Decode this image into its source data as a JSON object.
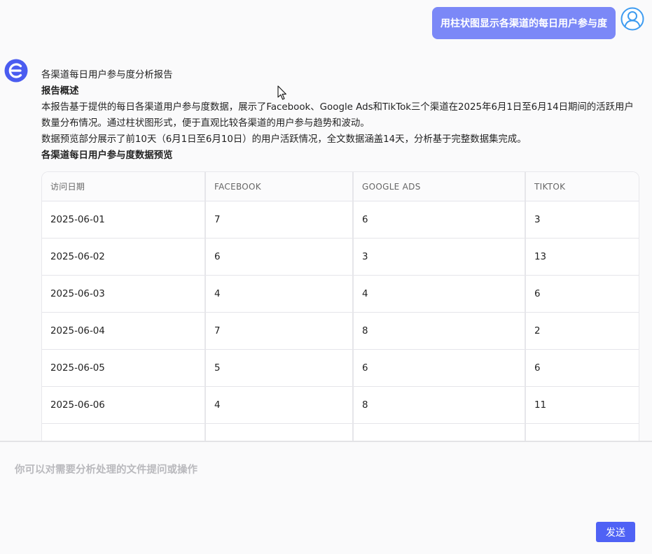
{
  "user_message": {
    "text": "用柱状图显示各渠道的每日用户参与度"
  },
  "report": {
    "title": "各渠道每日用户参与度分析报告",
    "overview_heading": "报告概述",
    "overview_text": "本报告基于提供的每日各渠道用户参与度数据，展示了Facebook、Google Ads和TikTok三个渠道在2025年6月1日至6月14日期间的活跃用户数量分布情况。通过柱状图形式，便于直观比较各渠道的用户参与趋势和波动。",
    "preview_text": "数据预览部分展示了前10天（6月1日至6月10日）的用户活跃情况，全文数据涵盖14天，分析基于完整数据集完成。",
    "table_heading": "各渠道每日用户参与度数据预览"
  },
  "table": {
    "headers": [
      "访问日期",
      "FACEBOOK",
      "GOOGLE ADS",
      "TIKTOK"
    ],
    "rows": [
      [
        "2025-06-01",
        "7",
        "6",
        "3"
      ],
      [
        "2025-06-02",
        "6",
        "3",
        "13"
      ],
      [
        "2025-06-03",
        "4",
        "4",
        "6"
      ],
      [
        "2025-06-04",
        "7",
        "8",
        "2"
      ],
      [
        "2025-06-05",
        "5",
        "6",
        "6"
      ],
      [
        "2025-06-06",
        "4",
        "8",
        "11"
      ],
      [
        "",
        "",
        "",
        ""
      ]
    ]
  },
  "composer": {
    "placeholder": "你可以对需要分析处理的文件提问或操作",
    "send_label": "发送"
  },
  "colors": {
    "user_bubble": "#7b88f7",
    "accent": "#4f62f5",
    "bot_logo": "#4a5cf0",
    "user_avatar": "#3d9bf0"
  }
}
